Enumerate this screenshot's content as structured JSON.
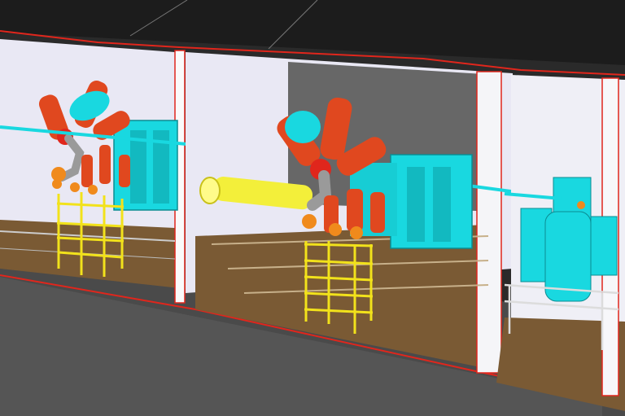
{
  "scene": {
    "type": "3d-cad-render",
    "description_tags": [
      "substation",
      "gas-insulated-switchgear",
      "transformer-bays"
    ],
    "colors": {
      "background": "#1f1f1f",
      "floor_dark": "#4d4d4d",
      "bay_floor": "#7a5a34",
      "wall": "#e7e6f3",
      "wall_edge": "#ffffff",
      "outline": "#e0261c",
      "transformer": "#19d8e0",
      "bushing": "#e0481f",
      "steel_frame": "#f2e21b",
      "duct": "#f3ef3a",
      "pipe_grey": "#9a9a9a"
    },
    "bays": [
      {
        "name": "bay-left",
        "has_transformer": true,
        "has_gis": true
      },
      {
        "name": "bay-center",
        "has_transformer": true,
        "has_gis": true
      },
      {
        "name": "bay-right",
        "has_transformer": true,
        "has_gis": false
      }
    ],
    "icons": [
      "bushing-insulator-icon",
      "transformer-tank-icon",
      "steel-support-frame-icon",
      "bus-duct-icon"
    ]
  }
}
